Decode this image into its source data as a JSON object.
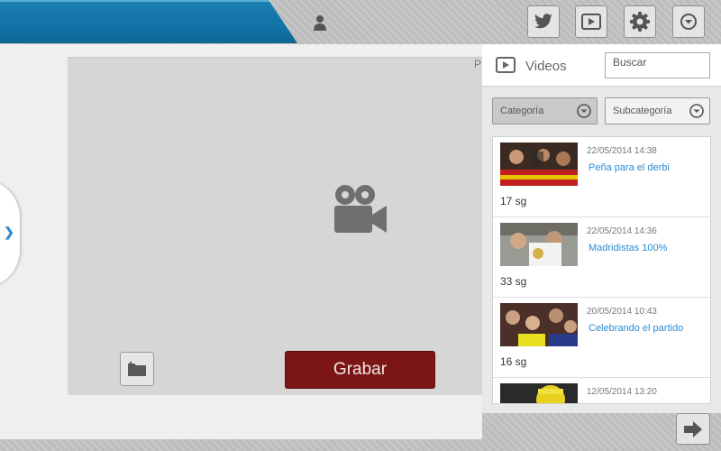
{
  "header": {
    "icons": [
      "user-icon",
      "twitter-icon",
      "youtube-icon",
      "gear-icon",
      "dropdown-icon"
    ]
  },
  "recorder": {
    "record_label": "Grabar",
    "folder_icon": "folder-icon",
    "camera_icon": "video-camera-icon",
    "cut_text": "P"
  },
  "panel": {
    "title": "Videos",
    "search_placeholder": "Buscar",
    "category_label": "Categoría",
    "subcategory_label": "Subcategoría"
  },
  "videos": [
    {
      "date": "22/05/2014 14:38",
      "title": "Peña para el derbi",
      "duration": "17 sg"
    },
    {
      "date": "22/05/2014 14:36",
      "title": "Madridistas 100%",
      "duration": "33 sg"
    },
    {
      "date": "20/05/2014 10:43",
      "title": "Celebrando el partido",
      "duration": "16 sg"
    },
    {
      "date": "12/05/2014 13:20",
      "title": "",
      "duration": ""
    }
  ],
  "colors": {
    "brand_blue": "#1170a3",
    "record_red": "#7c1616",
    "link_blue": "#2b8bd3"
  }
}
